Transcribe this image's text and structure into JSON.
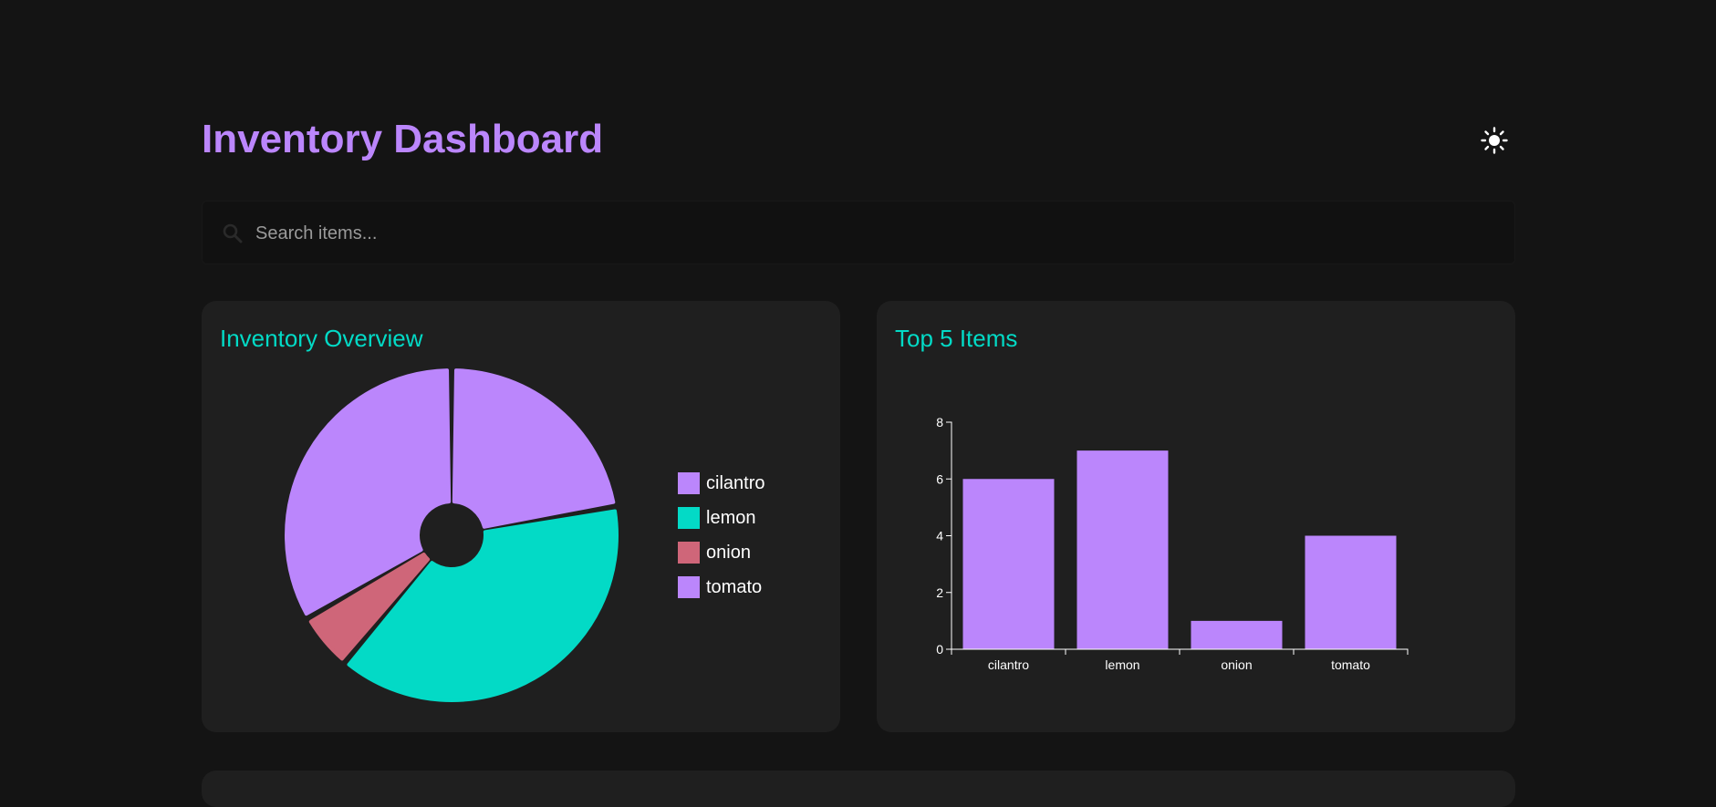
{
  "header": {
    "title": "Inventory Dashboard",
    "theme_icon": "sun-icon"
  },
  "search": {
    "placeholder": "Search items...",
    "value": "",
    "icon": "search-icon"
  },
  "colors": {
    "accent": "#bb86fc",
    "secondary": "#03dac6",
    "danger": "#cf6679",
    "background": "#141414",
    "card": "#1f1f1f"
  },
  "cards": {
    "overview": {
      "title": "Inventory Overview"
    },
    "top_items": {
      "title": "Top 5 Items"
    }
  },
  "chart_data": [
    {
      "type": "pie",
      "title": "Inventory Overview",
      "labels": [
        "cilantro",
        "lemon",
        "onion",
        "tomato"
      ],
      "values": [
        6,
        7,
        1,
        4
      ],
      "colors": [
        "#bb86fc",
        "#03dac6",
        "#cf6679",
        "#bb86fc"
      ],
      "legend": "right"
    },
    {
      "type": "bar",
      "title": "Top 5 Items",
      "categories": [
        "cilantro",
        "lemon",
        "onion",
        "tomato"
      ],
      "values": [
        6,
        7,
        1,
        4
      ],
      "color": "#bb86fc",
      "ylim": [
        0,
        8
      ],
      "yticks": [
        "0",
        "2",
        "4",
        "6",
        "8"
      ],
      "grid": false
    }
  ]
}
